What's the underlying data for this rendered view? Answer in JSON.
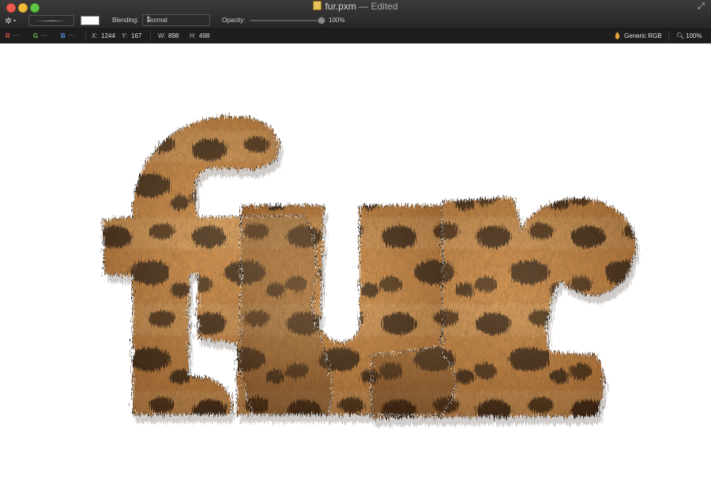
{
  "window": {
    "title": "fur.pxm",
    "title_suffix": " — Edited",
    "doc_icon": "document-icon",
    "fullscreen_icon": "fullscreen-arrows-icon"
  },
  "toolbar": {
    "settings_icon": "gear-icon",
    "blending_label": "Blending:",
    "blending_value": "Normal",
    "opacity_label": "Opacity:",
    "opacity_value": "100%",
    "opacity_fraction": 1.0,
    "color_swatch": "#ffffff"
  },
  "infobar": {
    "channels": [
      {
        "label": "R",
        "value": "---",
        "color": "#e2503f"
      },
      {
        "label": "G",
        "value": "---",
        "color": "#62c24a"
      },
      {
        "label": "B",
        "value": "---",
        "color": "#4f8fe6"
      }
    ],
    "x_label": "X:",
    "x_value": "1244",
    "y_label": "Y:",
    "y_value": "167",
    "w_label": "W:",
    "w_value": "898",
    "h_label": "H:",
    "h_value": "498",
    "color_profile": "Generic RGB",
    "zoom": "100%"
  },
  "canvas": {
    "artwork_text": "fur",
    "fur_colors": {
      "light": "#d99a55",
      "mid": "#b8692a",
      "dark": "#2b1a0e"
    }
  }
}
